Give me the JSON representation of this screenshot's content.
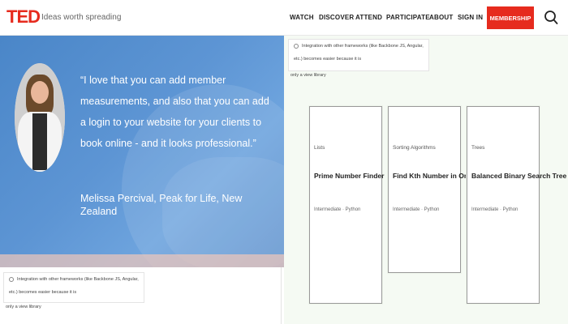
{
  "header": {
    "logo": "TED",
    "tagline": "Ideas worth spreading",
    "nav": [
      "WATCH",
      "DISCOVER",
      "ATTEND",
      "PARTICIPATE",
      "ABOUT",
      "SIGN IN"
    ],
    "membership_label": "MEMBERSHIP",
    "brand_color": "#e62b1e"
  },
  "hero": {
    "quote": "“I love that you can add member measurements, and also that you can add a login to your website for your clients to book online - and it looks professional.”",
    "author": "Melissa Percival, Peak for Life, New Zealand"
  },
  "notes": {
    "top_text": "Integration with other frameworks (like Backbone JS, Angular, etc.) becomes easier because it is",
    "top_overflow": "only a view library",
    "bottom_text": "Integration with other frameworks (like Backbone JS, Angular, etc.) becomes easier because it is",
    "bottom_overflow": "only a view library"
  },
  "cards": [
    {
      "category": "Lists",
      "title": "Prime Number Finder",
      "meta": "Intermediate · Python"
    },
    {
      "category": "Sorting Algorithms",
      "title": "Find Kth Number in Order",
      "meta": "Intermediate · Python"
    },
    {
      "category": "Trees",
      "title": "Balanced Binary Search Tree",
      "meta": "Intermediate · Python"
    }
  ]
}
